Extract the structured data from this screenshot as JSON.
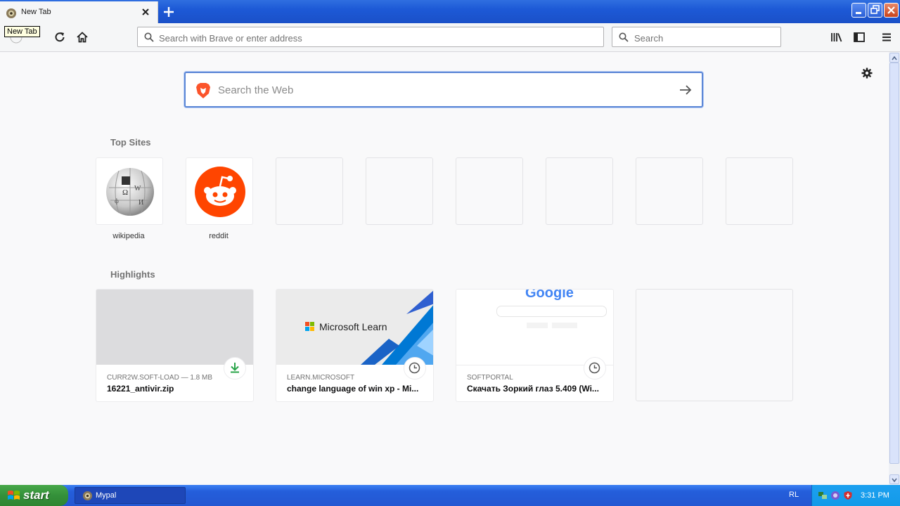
{
  "window": {
    "tab_title": "New Tab",
    "tooltip": "New Tab",
    "controls": [
      "minimize",
      "restore",
      "close"
    ]
  },
  "navbar": {
    "url_placeholder": "Search with Brave or enter address",
    "search_placeholder": "Search"
  },
  "newtab": {
    "search_placeholder": "Search the Web",
    "top_sites_title": "Top Sites",
    "top_sites": [
      {
        "label": "wikipedia",
        "icon": "wikipedia-globe-icon"
      },
      {
        "label": "reddit",
        "icon": "reddit-alien-icon"
      },
      {
        "label": ""
      },
      {
        "label": ""
      },
      {
        "label": ""
      },
      {
        "label": ""
      },
      {
        "label": ""
      },
      {
        "label": ""
      }
    ],
    "highlights_title": "Highlights",
    "highlights": [
      {
        "context": "CURR2W.SOFT-LOAD — 1.8 MB",
        "title": "16221_antivir.zip",
        "badge": "download-icon"
      },
      {
        "context": "LEARN.MICROSOFT",
        "title": "change language of win xp - Mi...",
        "badge": "clock-icon",
        "thumb_text": "Microsoft Learn"
      },
      {
        "context": "SOFTPORTAL",
        "title": "Скачать Зоркий глаз 5.409 (Wi...",
        "badge": "clock-icon",
        "thumb_text": "Google"
      }
    ]
  },
  "taskbar": {
    "start_label": "start",
    "task_label": "Mypal",
    "language": "RL",
    "clock": "3:31 PM"
  },
  "colors": {
    "brave_orange": "#fb542b",
    "reddit_orange": "#ff4500",
    "xp_blue": "#245edb",
    "xp_green": "#34903a"
  }
}
